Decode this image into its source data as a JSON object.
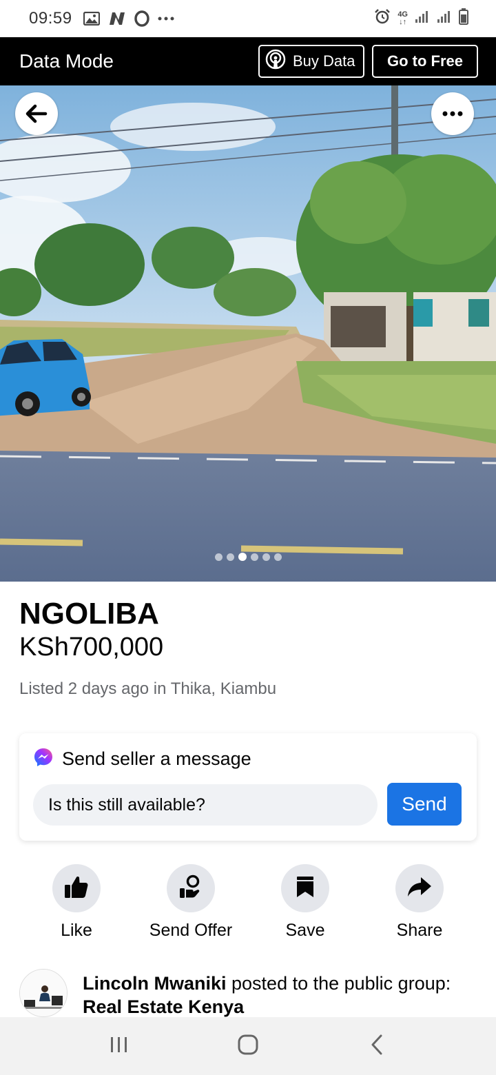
{
  "status_bar": {
    "time": "09:59",
    "network": "4G",
    "icons": [
      "image-icon",
      "n-icon",
      "opera-icon",
      "more-dots-icon",
      "alarm-icon",
      "signal-icon",
      "signal-icon-2",
      "battery-icon"
    ]
  },
  "data_mode": {
    "title": "Data Mode",
    "buy_data_label": "Buy Data",
    "go_free_label": "Go to Free"
  },
  "photo": {
    "slide_count": 6,
    "active_slide": 3
  },
  "listing": {
    "title": "NGOLIBA",
    "price": "KSh700,000",
    "meta": "Listed 2 days ago in Thika, Kiambu"
  },
  "message": {
    "header": "Send seller a message",
    "input_value": "Is this still available?",
    "send_label": "Send"
  },
  "actions": [
    {
      "label": "Like",
      "icon": "thumbs-up-icon"
    },
    {
      "label": "Send Offer",
      "icon": "offer-icon"
    },
    {
      "label": "Save",
      "icon": "bookmark-icon"
    },
    {
      "label": "Share",
      "icon": "share-icon"
    }
  ],
  "post": {
    "author": "Lincoln Mwaniki",
    "action_text": " posted to the public group:",
    "group": "Real Estate Kenya"
  },
  "colors": {
    "accent": "#1b74e4",
    "data_bar": "#000000",
    "secondary_text": "#65676b",
    "action_bg": "#e4e6eb"
  }
}
